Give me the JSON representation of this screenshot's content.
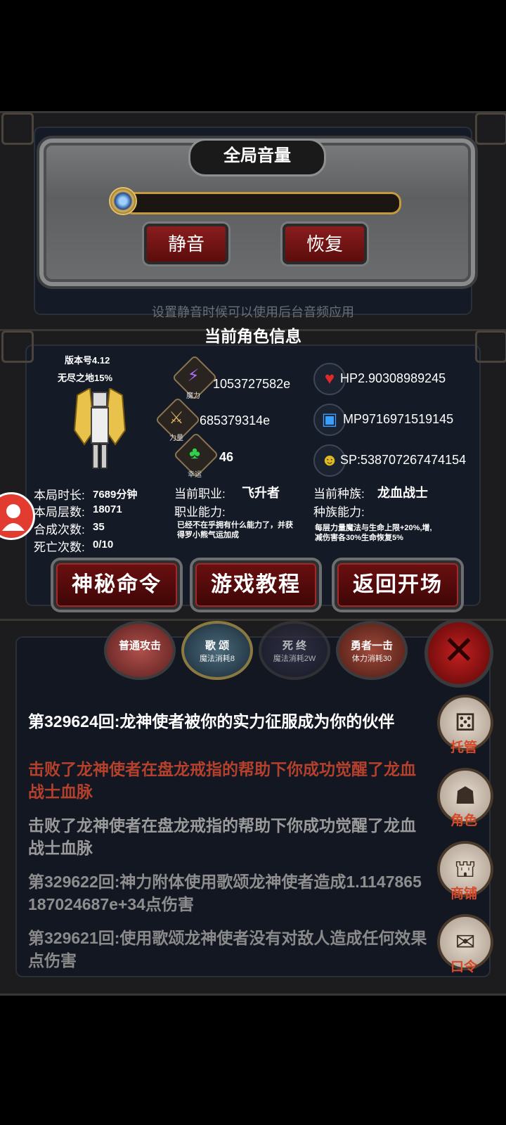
{
  "volume": {
    "title": "全局音量",
    "mute_label": "静音",
    "restore_label": "恢复",
    "hint": "设置静音时候可以使用后台音频应用",
    "level": 0.0
  },
  "char": {
    "section_title": "当前角色信息",
    "version": "版本号4.12",
    "area": "无尽之地15%",
    "magic_value": "1053727582e",
    "magic_caption": "魔力",
    "strength_value": "685379314e",
    "strength_caption": "力量",
    "luck_value": "46",
    "luck_caption": "幸运",
    "hp": "HP2.90308989245",
    "mp": "MP9716971519145",
    "sp": "SP:538707267474154",
    "stats": [
      {
        "label": "本局时长:",
        "value": "7689分钟"
      },
      {
        "label": "本局层数:",
        "value": "18071"
      },
      {
        "label": "合成次数:",
        "value": "35"
      },
      {
        "label": "死亡次数:",
        "value": "0/10"
      }
    ],
    "job_label": "当前职业:",
    "job_value": "飞升者",
    "job_ability_label": "职业能力:",
    "job_ability_text": "已经不在乎拥有什么能力了，并获得罗小熊气运加成",
    "race_label": "当前种族:",
    "race_value": "龙血战士",
    "race_ability_label": "种族能力:",
    "race_ability_text": "每层力量魔法与生命上限+20%,增,减伤害各30%生命恢复5%"
  },
  "buttons": {
    "secret": "神秘命令",
    "tutorial": "游戏教程",
    "back": "返回开场"
  },
  "skills": [
    {
      "name": "普通攻击",
      "cost": ""
    },
    {
      "name": "歌 颂",
      "cost": "魔法消耗8"
    },
    {
      "name": "死 终",
      "cost": "魔法消耗2W"
    },
    {
      "name": "勇者一击",
      "cost": "体力消耗30"
    }
  ],
  "log": [
    {
      "text": "第329624回:龙神使者被你的实力征服成为你的伙伴",
      "color": "#ffffff"
    },
    {
      "text": "击败了龙神使者在盘龙戒指的帮助下你成功觉醒了龙血战士血脉",
      "color": "#b5402c"
    },
    {
      "text": "击败了龙神使者在盘龙戒指的帮助下你成功觉醒了龙血战士血脉",
      "color": "#9a9a9a"
    },
    {
      "text": "第329622回:神力附体使用歌颂龙神使者造成1.1147865187024687e+34点伤害",
      "color": "#8e8e8e"
    },
    {
      "text": "第329621回:使用歌颂龙神使者没有对敌人造成任何效果点伤害",
      "color": "#8a8a8a"
    }
  ],
  "side": {
    "auto": "托管",
    "role": "角色",
    "shop": "商铺",
    "code": "口令"
  }
}
